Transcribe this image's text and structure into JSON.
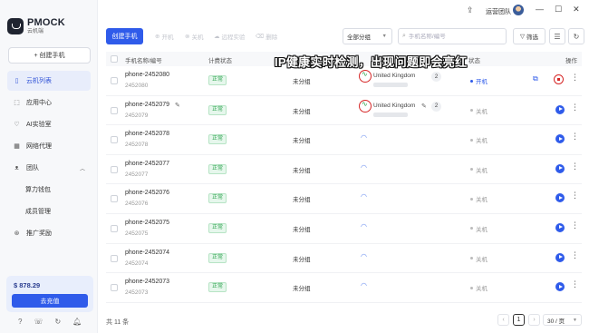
{
  "app": {
    "name": "PMOCK",
    "sub": "云机端"
  },
  "topbar": {
    "team": "运营团队"
  },
  "sidebar": {
    "create_label": "+ 创建手机",
    "items": [
      {
        "label": "云机列表",
        "icon": "phone-icon"
      },
      {
        "label": "应用中心",
        "icon": "apps-icon"
      },
      {
        "label": "AI实验室",
        "icon": "ai-icon"
      },
      {
        "label": "网络代理",
        "icon": "network-icon"
      },
      {
        "label": "团队",
        "icon": "team-icon"
      },
      {
        "label": "算力钱包",
        "icon": ""
      },
      {
        "label": "成员管理",
        "icon": ""
      },
      {
        "label": "推广奖励",
        "icon": "reward-icon"
      }
    ],
    "balance": "$ 878.29",
    "recharge": "去充值"
  },
  "toolbar": {
    "create": "创建手机",
    "batch": [
      "开机",
      "关机",
      "远程实验",
      "删除"
    ],
    "group_select": "全部分组",
    "search_placeholder": "手机名称/编号",
    "filter": "筛选"
  },
  "table": {
    "headers": {
      "name": "手机名称/编号",
      "billing": "计费状态",
      "status": "状态",
      "action": "操作"
    },
    "rows": [
      {
        "name": "phone-2452080",
        "num": "2452080",
        "billing": "正常",
        "group": "未分组",
        "country": "United Kingdom",
        "count": "2",
        "power": "开机",
        "on": true
      },
      {
        "name": "phone-2452079",
        "num": "2452079",
        "billing": "正常",
        "group": "未分组",
        "country": "United Kingdom",
        "count": "2",
        "power": "关机",
        "on": false
      },
      {
        "name": "phone-2452078",
        "num": "2452078",
        "billing": "正常",
        "group": "未分组",
        "power": "关机",
        "on": false
      },
      {
        "name": "phone-2452077",
        "num": "2452077",
        "billing": "正常",
        "group": "未分组",
        "power": "关机",
        "on": false
      },
      {
        "name": "phone-2452076",
        "num": "2452076",
        "billing": "正常",
        "group": "未分组",
        "power": "关机",
        "on": false
      },
      {
        "name": "phone-2452075",
        "num": "2452075",
        "billing": "正常",
        "group": "未分组",
        "power": "关机",
        "on": false
      },
      {
        "name": "phone-2452074",
        "num": "2452074",
        "billing": "正常",
        "group": "未分组",
        "power": "关机",
        "on": false
      },
      {
        "name": "phone-2452073",
        "num": "2452073",
        "billing": "正常",
        "group": "未分组",
        "power": "关机",
        "on": false
      }
    ]
  },
  "footer": {
    "total": "共 11 条",
    "page": "1",
    "page_size": "30 / 页"
  },
  "caption": "IP健康实时检测，出现问题即会亮红"
}
